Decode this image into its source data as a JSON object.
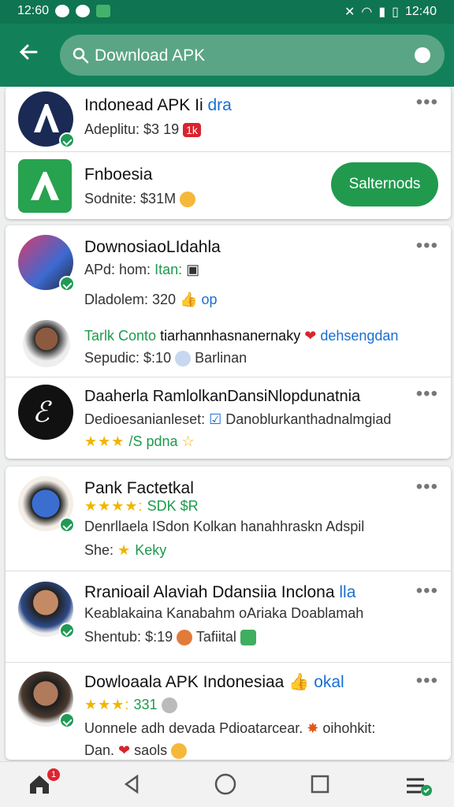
{
  "status_bar": {
    "time_left": "12:60",
    "time_right": "12:40"
  },
  "header": {
    "search": {
      "query": "Download APK"
    }
  },
  "results": [
    {
      "title": "Indonead APK Ii",
      "title_suffix": "dra",
      "subtitle": "Adeplitu: $3 19",
      "chip": "1k"
    },
    {
      "title": "Fnboesia",
      "subtitle": "Sodnite: $31M",
      "button": "Salternods"
    },
    {
      "title": "DownosiaoLIdahla",
      "meta": "APd: hom:",
      "meta_accent": "Itan:",
      "line2": "Dladolem: 320",
      "line2_accent": "op"
    },
    {
      "title": "Tarlk Conto",
      "title_rest": "tiarhannhasnanernaky",
      "title_accent": "dehsengdan",
      "subtitle": "Sepudic: $:10",
      "subtitle_rest": "Barlinan"
    },
    {
      "title": "Daaherla RamlolkanDansiNlopdunatnia",
      "line2": "Dedioesanianleset:",
      "line2_rest": "Danoblurkanthadnalmgiad",
      "stars": "★★★",
      "line3": "/S pdna"
    },
    {
      "title": "Pank Factetkal",
      "stars": "★★★★:",
      "stars_text": "SDK $R",
      "line2": "Denrllaela ISdon Kolkan  hanahhraskn Adspil",
      "line3": "She:",
      "line3_accent": "Keky"
    },
    {
      "title": "Rranioail Alaviah Ddansiia Inclona",
      "title_accent": "lla",
      "line2": "Keablakaina Kanabahm oAriaka Doablamah",
      "line3": "Shentub: $:19",
      "line3_rest": "Tafiital"
    },
    {
      "title": "Dowloaala APK Indonesiaa",
      "title_accent": "okal",
      "stars": "★★★:",
      "stars_text": "331",
      "line2": "Uonnele adh devada Pdioatarcear.",
      "line2_rest": "oihohkit:",
      "line3": "Dan.",
      "line3_rest": "saols"
    }
  ],
  "nav": {
    "home_badge": "1"
  },
  "colors": {
    "primary": "#12815a",
    "accent": "#219a4e",
    "star": "#f1b500"
  }
}
